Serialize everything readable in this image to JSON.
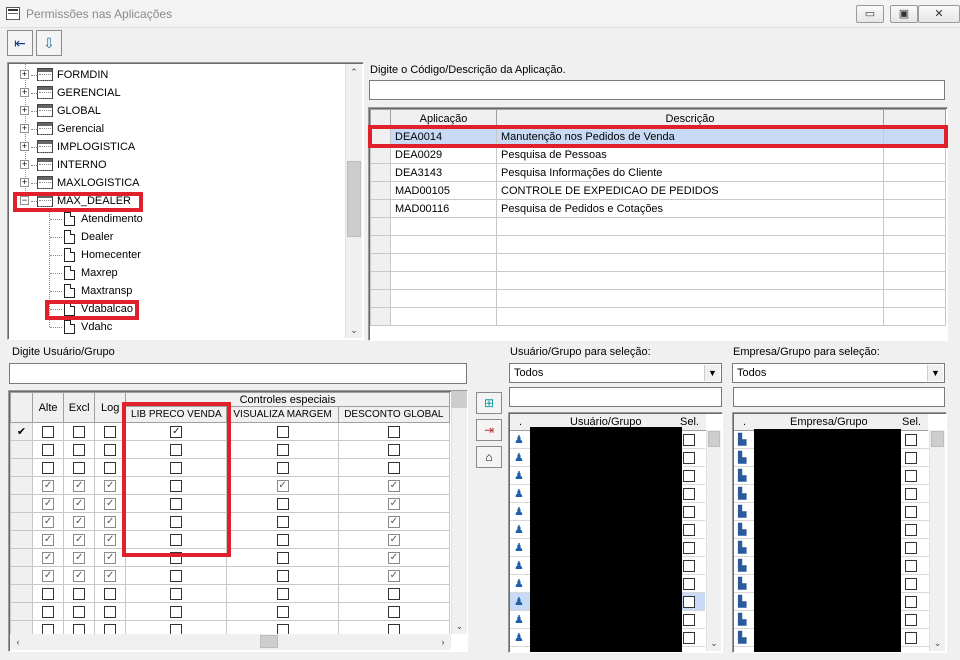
{
  "window": {
    "title": "Permissões nas Aplicações",
    "controls": {
      "minimize": "▭",
      "restore": "▣",
      "close": "✕"
    }
  },
  "toolbar": {
    "exit_icon": "exit-icon",
    "save_icon": "save-icon"
  },
  "tree": {
    "items": [
      {
        "label": "FORMDIN",
        "type": "module"
      },
      {
        "label": "GERENCIAL",
        "type": "module"
      },
      {
        "label": "GLOBAL",
        "type": "module"
      },
      {
        "label": "Gerencial",
        "type": "module"
      },
      {
        "label": "IMPLOGISTICA",
        "type": "module"
      },
      {
        "label": "INTERNO",
        "type": "module"
      },
      {
        "label": "MAXLOGISTICA",
        "type": "module"
      },
      {
        "label": "MAX_DEALER",
        "type": "module",
        "expanded": true
      },
      {
        "label": "Atendimento",
        "type": "app"
      },
      {
        "label": "Dealer",
        "type": "app"
      },
      {
        "label": "Homecenter",
        "type": "app"
      },
      {
        "label": "Maxrep",
        "type": "app"
      },
      {
        "label": "Maxtransp",
        "type": "app"
      },
      {
        "label": "Vdabalcao",
        "type": "app"
      },
      {
        "label": "Vdahc",
        "type": "app"
      }
    ]
  },
  "app_search": {
    "label": "Digite o Código/Descrição da Aplicação.",
    "value": ""
  },
  "app_grid": {
    "headers": {
      "col1": "Aplicação",
      "col2": "Descrição"
    },
    "rows": [
      {
        "code": "DEA0014",
        "desc": "Manutenção nos Pedidos de Venda"
      },
      {
        "code": "DEA0029",
        "desc": "Pesquisa de Pessoas"
      },
      {
        "code": "DEA3143",
        "desc": "Pesquisa Informações do Cliente"
      },
      {
        "code": "MAD00105",
        "desc": "CONTROLE DE EXPEDICAO DE PEDIDOS"
      },
      {
        "code": "MAD00116",
        "desc": "Pesquisa de Pedidos e Cotações"
      }
    ]
  },
  "user_search": {
    "label": "Digite Usuário/Grupo",
    "value": ""
  },
  "perm_grid": {
    "headers": {
      "alte": "Alte",
      "excl": "Excl",
      "log": "Log",
      "special": "Controles especiais",
      "c1": "LIB PRECO VENDA",
      "c2": "VISUALIZA MARGEM",
      "c3": "DESCONTO GLOBAL"
    },
    "row_marker": "✔",
    "rows": [
      [
        0,
        0,
        0,
        1,
        0,
        0
      ],
      [
        0,
        0,
        0,
        0,
        0,
        0
      ],
      [
        0,
        0,
        0,
        0,
        0,
        0
      ],
      [
        1,
        1,
        1,
        0,
        1,
        1
      ],
      [
        1,
        1,
        1,
        0,
        0,
        1
      ],
      [
        1,
        1,
        1,
        0,
        0,
        1
      ],
      [
        1,
        1,
        1,
        0,
        0,
        1
      ],
      [
        1,
        1,
        1,
        0,
        0,
        1
      ],
      [
        1,
        1,
        1,
        0,
        0,
        1
      ],
      [
        0,
        0,
        0,
        0,
        0,
        0
      ],
      [
        0,
        0,
        0,
        0,
        0,
        0
      ],
      [
        0,
        0,
        0,
        0,
        0,
        0
      ]
    ]
  },
  "user_select": {
    "label": "Usuário/Grupo para seleção:",
    "value": "Todos",
    "headers": {
      "dot": ".",
      "name": "Usuário/Grupo",
      "sel": "Sel."
    }
  },
  "company_select": {
    "label": "Empresa/Grupo para seleção:",
    "value": "Todos",
    "headers": {
      "dot": ".",
      "name": "Empresa/Grupo",
      "sel": "Sel."
    }
  }
}
